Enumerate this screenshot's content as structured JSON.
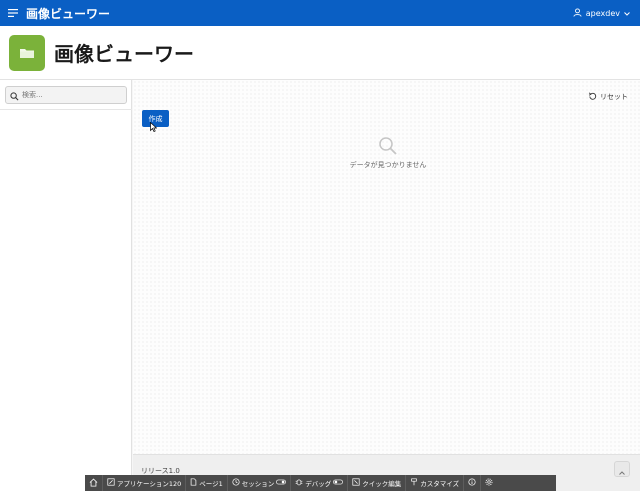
{
  "navbar": {
    "menu_icon": "hamburger-icon",
    "title": "画像ビューワー",
    "user": "apexdev",
    "user_icon": "user-icon",
    "dropdown_icon": "chevron-down-icon"
  },
  "header": {
    "icon": "folder-icon",
    "title": "画像ビューワー"
  },
  "search": {
    "placeholder": "検索...",
    "value": ""
  },
  "toolbar": {
    "reset_label": "リセット",
    "create_label": "作成"
  },
  "empty_state": {
    "message": "データが見つかりません"
  },
  "footer": {
    "release": "リリース1.0"
  },
  "devbar": {
    "items": [
      {
        "icon": "home-icon",
        "label": ""
      },
      {
        "icon": "edit-icon",
        "label": "アプリケーション120"
      },
      {
        "icon": "page-icon",
        "label": "ページ1"
      },
      {
        "icon": "session-icon",
        "label": "セッション"
      },
      {
        "icon": "debug-icon",
        "label": "デバッグ"
      },
      {
        "icon": "quick-edit-icon",
        "label": "クイック編集"
      },
      {
        "icon": "customize-icon",
        "label": "カスタマイズ"
      },
      {
        "icon": "info-icon",
        "label": ""
      },
      {
        "icon": "settings-icon",
        "label": ""
      }
    ]
  },
  "colors": {
    "primary": "#0a5fc4",
    "hero_icon": "#7bb23a",
    "devbar": "#4a4a4a"
  }
}
